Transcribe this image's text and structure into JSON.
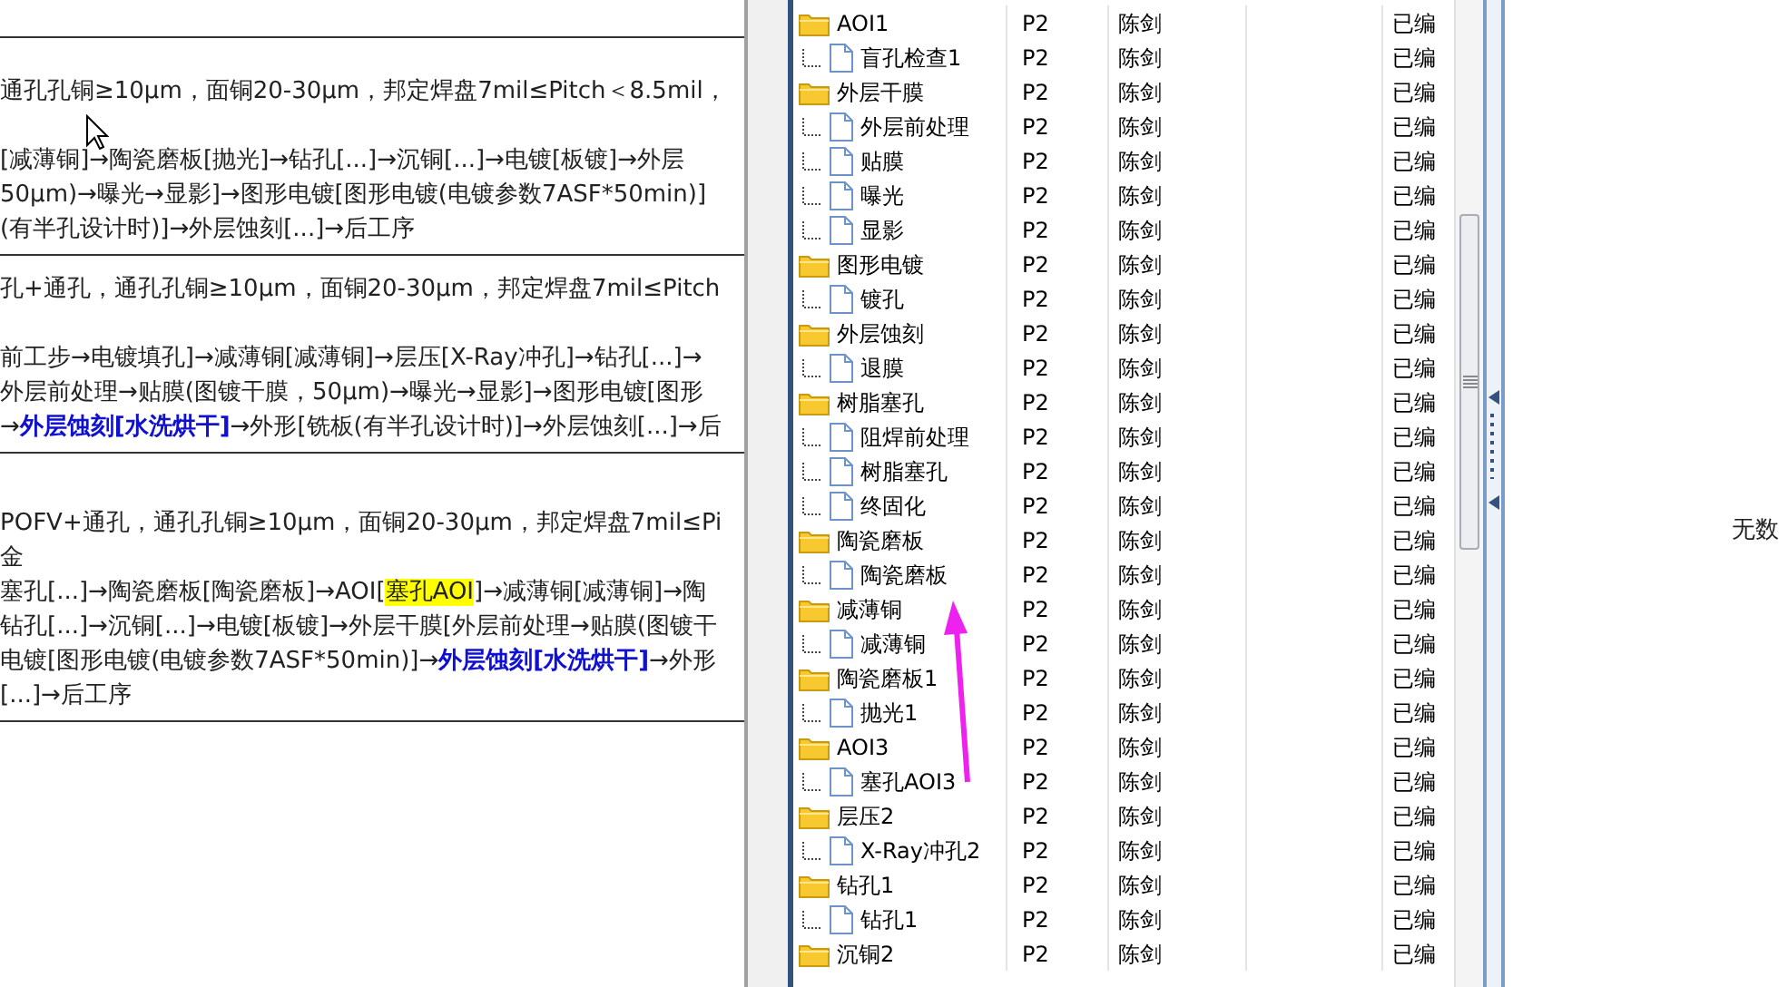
{
  "left_pane": {
    "blocks": [
      {
        "summary_lines": [
          [
            {
              "kind": "plain",
              "text": "通孔孔铜≥10μm，面铜20-30μm，邦定焊盘7mil≤Pitch＜8.5mil，"
            }
          ]
        ],
        "route_lines": [
          [
            {
              "kind": "plain",
              "text": "[减薄铜]→陶瓷磨板[抛光]→钻孔[...]→沉铜[...]→电镀[板镀]→外层"
            }
          ],
          [
            {
              "kind": "plain",
              "text": "50μm)→曝光→显影]→图形电镀[图形电镀(电镀参数7ASF*50min)]"
            }
          ],
          [
            {
              "kind": "plain",
              "text": "(有半孔设计时)]→外层蚀刻[...]→后工序"
            }
          ]
        ]
      },
      {
        "summary_lines": [
          [
            {
              "kind": "plain",
              "text": "孔+通孔，通孔孔铜≥10μm，面铜20-30μm，邦定焊盘7mil≤Pitch"
            }
          ]
        ],
        "route_lines": [
          [
            {
              "kind": "plain",
              "text": "前工步→电镀填孔]→减薄铜[减薄铜]→层压[X-Ray冲孔]→钻孔[...]→"
            }
          ],
          [
            {
              "kind": "plain",
              "text": "外层前处理→贴膜(图镀干膜，50μm)→曝光→显影]→图形电镀[图形"
            }
          ],
          [
            {
              "kind": "plain",
              "text": "→"
            },
            {
              "kind": "emphasis",
              "text": "外层蚀刻[水洗烘干]"
            },
            {
              "kind": "plain",
              "text": "→外形[铣板(有半孔设计时)]→外层蚀刻[...]→后"
            }
          ]
        ]
      },
      {
        "summary_lines": [
          [
            {
              "kind": "plain",
              "text": "POFV+通孔，通孔孔铜≥10μm，面铜20-30μm，邦定焊盘7mil≤Pi"
            }
          ],
          [
            {
              "kind": "plain",
              "text": "金"
            }
          ]
        ],
        "route_lines": [
          [
            {
              "kind": "plain",
              "text": "塞孔[...]→陶瓷磨板[陶瓷磨板]→AOI["
            },
            {
              "kind": "highlight",
              "text": "塞孔AOI"
            },
            {
              "kind": "plain",
              "text": "]→减薄铜[减薄铜]→陶"
            }
          ],
          [
            {
              "kind": "plain",
              "text": "钻孔[...]→沉铜[...]→电镀[板镀]→外层干膜[外层前处理→贴膜(图镀干"
            }
          ],
          [
            {
              "kind": "plain",
              "text": "电镀[图形电镀(电镀参数7ASF*50min)]→"
            },
            {
              "kind": "emphasis",
              "text": "外层蚀刻[水洗烘干]"
            },
            {
              "kind": "plain",
              "text": "→外形"
            }
          ],
          [
            {
              "kind": "plain",
              "text": "[...]→后工序"
            }
          ]
        ]
      }
    ]
  },
  "tree": {
    "nodes": [
      {
        "name": "AOI1",
        "column_2": "P2",
        "column_3": "陈剑",
        "column_5": "已编",
        "children": [
          {
            "name": "盲孔检查1",
            "column_2": "P2",
            "column_3": "陈剑",
            "column_5": "已编"
          }
        ]
      },
      {
        "name": "外层干膜",
        "column_2": "P2",
        "column_3": "陈剑",
        "column_5": "已编",
        "children": [
          {
            "name": "外层前处理",
            "column_2": "P2",
            "column_3": "陈剑",
            "column_5": "已编"
          },
          {
            "name": "贴膜",
            "column_2": "P2",
            "column_3": "陈剑",
            "column_5": "已编"
          },
          {
            "name": "曝光",
            "column_2": "P2",
            "column_3": "陈剑",
            "column_5": "已编"
          },
          {
            "name": "显影",
            "column_2": "P2",
            "column_3": "陈剑",
            "column_5": "已编"
          }
        ]
      },
      {
        "name": "图形电镀",
        "column_2": "P2",
        "column_3": "陈剑",
        "column_5": "已编",
        "children": [
          {
            "name": "镀孔",
            "column_2": "P2",
            "column_3": "陈剑",
            "column_5": "已编"
          }
        ]
      },
      {
        "name": "外层蚀刻",
        "column_2": "P2",
        "column_3": "陈剑",
        "column_5": "已编",
        "children": [
          {
            "name": "退膜",
            "column_2": "P2",
            "column_3": "陈剑",
            "column_5": "已编"
          }
        ]
      },
      {
        "name": "树脂塞孔",
        "column_2": "P2",
        "column_3": "陈剑",
        "column_5": "已编",
        "children": [
          {
            "name": "阻焊前处理",
            "column_2": "P2",
            "column_3": "陈剑",
            "column_5": "已编"
          },
          {
            "name": "树脂塞孔",
            "column_2": "P2",
            "column_3": "陈剑",
            "column_5": "已编"
          },
          {
            "name": "终固化",
            "column_2": "P2",
            "column_3": "陈剑",
            "column_5": "已编"
          }
        ]
      },
      {
        "name": "陶瓷磨板",
        "column_2": "P2",
        "column_3": "陈剑",
        "column_5": "已编",
        "children": [
          {
            "name": "陶瓷磨板",
            "column_2": "P2",
            "column_3": "陈剑",
            "column_5": "已编"
          }
        ]
      },
      {
        "name": "减薄铜",
        "column_2": "P2",
        "column_3": "陈剑",
        "column_5": "已编",
        "children": [
          {
            "name": "减薄铜",
            "column_2": "P2",
            "column_3": "陈剑",
            "column_5": "已编"
          }
        ]
      },
      {
        "name": "陶瓷磨板1",
        "column_2": "P2",
        "column_3": "陈剑",
        "column_5": "已编",
        "children": [
          {
            "name": "抛光1",
            "column_2": "P2",
            "column_3": "陈剑",
            "column_5": "已编"
          }
        ]
      },
      {
        "name": "AOI3",
        "column_2": "P2",
        "column_3": "陈剑",
        "column_5": "已编",
        "children": [
          {
            "name": "塞孔AOI3",
            "column_2": "P2",
            "column_3": "陈剑",
            "column_5": "已编"
          }
        ]
      },
      {
        "name": "层压2",
        "column_2": "P2",
        "column_3": "陈剑",
        "column_5": "已编",
        "children": [
          {
            "name": "X-Ray冲孔2",
            "column_2": "P2",
            "column_3": "陈剑",
            "column_5": "已编"
          }
        ]
      },
      {
        "name": "钻孔1",
        "column_2": "P2",
        "column_3": "陈剑",
        "column_5": "已编",
        "children": [
          {
            "name": "钻孔1",
            "column_2": "P2",
            "column_3": "陈剑",
            "column_5": "已编"
          }
        ]
      },
      {
        "name": "沉铜2",
        "column_2": "P2",
        "column_3": "陈剑",
        "column_5": "已编"
      }
    ]
  },
  "right_pane": {
    "empty_message": "无数"
  }
}
